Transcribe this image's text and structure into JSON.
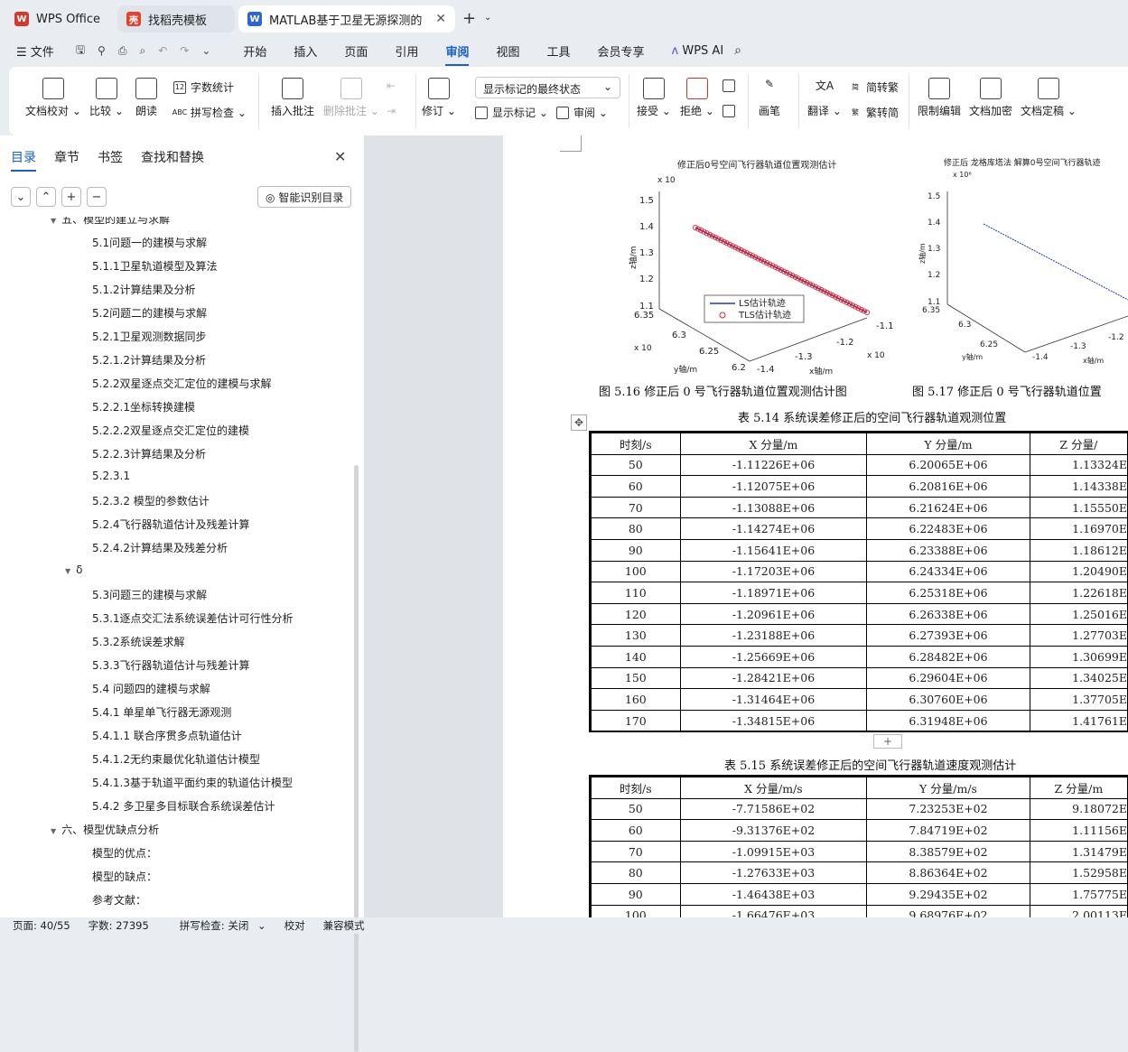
{
  "tabs": [
    {
      "label": "WPS Office"
    },
    {
      "label": "找稻壳模板"
    },
    {
      "label": "MATLAB基于卫星无源探测的空"
    }
  ],
  "menu": {
    "file": "文件",
    "items": [
      "开始",
      "插入",
      "页面",
      "引用",
      "审阅",
      "视图",
      "工具",
      "会员专享"
    ],
    "active": "审阅",
    "wps_ai": "WPS AI"
  },
  "ribbon": {
    "doc_check": "文档校对",
    "compare": "比较",
    "read_aloud": "朗读",
    "word_count": "字数统计",
    "spell_check": "拼写检查",
    "insert_comment": "插入批注",
    "delete_comment": "删除批注",
    "track": "修订",
    "markup_state": "显示标记的最终状态",
    "show_markup": "显示标记",
    "review": "审阅",
    "accept": "接受",
    "reject": "拒绝",
    "pen": "画笔",
    "translate": "翻译",
    "to_trad": "简转繁",
    "to_simp": "繁转简",
    "restrict": "限制编辑",
    "encrypt": "文档加密",
    "finalize": "文档定稿"
  },
  "nav": {
    "tabs": [
      "目录",
      "章节",
      "书签",
      "查找和替换"
    ],
    "smart_btn": "智能识别目录",
    "items": [
      {
        "text": "五、模型的建立与求解",
        "level": 1,
        "expand": "▼"
      },
      {
        "text": "5.1问题一的建模与求解",
        "level": 2
      },
      {
        "text": "5.1.1卫星轨道模型及算法",
        "level": 2
      },
      {
        "text": "5.1.2计算结果及分析",
        "level": 2
      },
      {
        "text": "5.2问题二的建模与求解",
        "level": 2
      },
      {
        "text": "5.2.1卫星观测数据同步",
        "level": 2
      },
      {
        "text": "5.2.1.2计算结果及分析",
        "level": 2
      },
      {
        "text": "5.2.2双星逐点交汇定位的建模与求解",
        "level": 2
      },
      {
        "text": "5.2.2.1坐标转换建模",
        "level": 2
      },
      {
        "text": "5.2.2.2双星逐点交汇定位的建模",
        "level": 2
      },
      {
        "text": "5.2.2.3计算结果及分析",
        "level": 2
      },
      {
        "text": "5.2.3.1",
        "level": 2
      },
      {
        "text": "5.2.3.2 模型的参数估计",
        "level": 2
      },
      {
        "text": "5.2.4飞行器轨道估计及残差计算",
        "level": 2
      },
      {
        "text": "5.2.4.2计算结果及残差分析",
        "level": 2
      },
      {
        "text": "δ",
        "level": 15,
        "expand": "▼"
      },
      {
        "text": "5.3问题三的建模与求解",
        "level": 2
      },
      {
        "text": "5.3.1逐点交汇法系统误差估计可行性分析",
        "level": 2
      },
      {
        "text": "5.3.2系统误差求解",
        "level": 2
      },
      {
        "text": "5.3.3飞行器轨道估计与残差计算",
        "level": 2
      },
      {
        "text": "5.4 问题四的建模与求解",
        "level": 2
      },
      {
        "text": "5.4.1 单星单飞行器无源观测",
        "level": 2
      },
      {
        "text": "5.4.1.1 联合序贯多点轨道估计",
        "level": 2
      },
      {
        "text": "5.4.1.2无约束最优化轨道估计模型",
        "level": 2
      },
      {
        "text": "5.4.1.3基于轨道平面约束的轨道估计模型",
        "level": 2
      },
      {
        "text": "5.4.2 多卫星多目标联合系统误差估计",
        "level": 2
      },
      {
        "text": "六、模型优缺点分析",
        "level": 1,
        "expand": "▼"
      },
      {
        "text": "模型的优点：",
        "level": 2
      },
      {
        "text": "模型的缺点：",
        "level": 2
      },
      {
        "text": "参考文献：",
        "level": 2
      }
    ]
  },
  "figures": {
    "fig1": {
      "title": "修正后0号空间飞行器轨道位置观测估计",
      "zlabel": "z轴/m",
      "ylabel": "y轴/m",
      "xlabel": "x轴/m",
      "z_exp": "x 10",
      "z_ticks": [
        "1.5",
        "1.4",
        "1.3",
        "1.2",
        "1.1"
      ],
      "y_ticks": [
        "6.35",
        "6.3",
        "6.25",
        "6.2"
      ],
      "y_exp": "x 10",
      "x_ticks": [
        "-1.4",
        "-1.3",
        "-1.2",
        "-1.1"
      ],
      "x_exp": "x 10",
      "legend": [
        "LS估计轨迹",
        "TLS估计轨迹"
      ],
      "caption": "图 5.16   修正后 0 号飞行器轨道位置观测估计图"
    },
    "fig2": {
      "title": "修正后 龙格库塔法 解算0号空间飞行器轨迹",
      "z_ticks": [
        "1.5",
        "1.4",
        "1.3",
        "1.2",
        "1.1"
      ],
      "y_ticks": [
        "6.35",
        "6.3",
        "6.25"
      ],
      "x_ticks": [
        "-1.4",
        "-1.3",
        "-1.2"
      ],
      "zlabel": "z轴/m",
      "ylabel": "y轴/m",
      "xlabel": "x轴/m",
      "caption": "图 5.17   修正后 0 号飞行器轨道位置"
    }
  },
  "table1": {
    "caption": "表 5.14   系统误差修正后的空间飞行器轨道观测位置",
    "headers": [
      "时刻/s",
      "X 分量/m",
      "Y 分量/m",
      "Z 分量/"
    ],
    "rows": [
      [
        "50",
        "-1.11226E+06",
        "6.20065E+06",
        "1.13324E"
      ],
      [
        "60",
        "-1.12075E+06",
        "6.20816E+06",
        "1.14338E"
      ],
      [
        "70",
        "-1.13088E+06",
        "6.21624E+06",
        "1.15550E"
      ],
      [
        "80",
        "-1.14274E+06",
        "6.22483E+06",
        "1.16970E"
      ],
      [
        "90",
        "-1.15641E+06",
        "6.23388E+06",
        "1.18612E"
      ],
      [
        "100",
        "-1.17203E+06",
        "6.24334E+06",
        "1.20490E"
      ],
      [
        "110",
        "-1.18971E+06",
        "6.25318E+06",
        "1.22618E"
      ],
      [
        "120",
        "-1.20961E+06",
        "6.26338E+06",
        "1.25016E"
      ],
      [
        "130",
        "-1.23188E+06",
        "6.27393E+06",
        "1.27703E"
      ],
      [
        "140",
        "-1.25669E+06",
        "6.28482E+06",
        "1.30699E"
      ],
      [
        "150",
        "-1.28421E+06",
        "6.29604E+06",
        "1.34025E"
      ],
      [
        "160",
        "-1.31464E+06",
        "6.30760E+06",
        "1.37705E"
      ],
      [
        "170",
        "-1.34815E+06",
        "6.31948E+06",
        "1.41761E"
      ]
    ]
  },
  "table2": {
    "caption": "表 5.15   系统误差修正后的空间飞行器轨道速度观测估计",
    "headers": [
      "时刻/s",
      "X 分量/m/s",
      "Y 分量/m/s",
      "Z 分量/m"
    ],
    "rows": [
      [
        "50",
        "-7.71586E+02",
        "7.23253E+02",
        "9.18072E"
      ],
      [
        "60",
        "-9.31376E+02",
        "7.84719E+02",
        "1.11156E"
      ],
      [
        "70",
        "-1.09915E+03",
        "8.38579E+02",
        "1.31479E"
      ],
      [
        "80",
        "-1.27633E+03",
        "8.86364E+02",
        "1.52958E"
      ],
      [
        "90",
        "-1.46438E+03",
        "9.29435E+02",
        "1.75775E"
      ],
      [
        "100",
        "-1.66476E+03",
        "9.68976E+02",
        "2.00113E"
      ]
    ]
  },
  "status": {
    "page": "页面: 40/55",
    "words": "字数: 27395",
    "spell": "拼写检查: 关闭",
    "proof": "校对",
    "compat": "兼容模式"
  }
}
